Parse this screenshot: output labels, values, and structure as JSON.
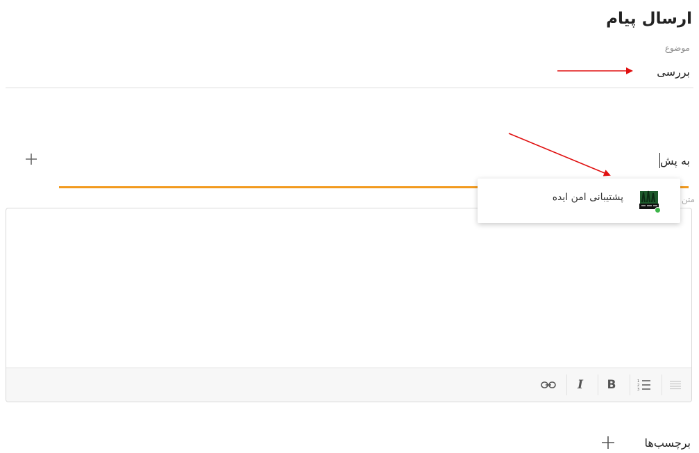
{
  "page": {
    "title": "ارسال پیام"
  },
  "subject": {
    "label": "موضوع",
    "value": "بررسی"
  },
  "to": {
    "value": "به پش",
    "add_icon": "plus-icon"
  },
  "body": {
    "label": "متن"
  },
  "suggestions": [
    {
      "name": "پشتیبانی امن ایده",
      "status": "online"
    }
  ],
  "toolbar": {
    "buttons": [
      "align-icon",
      "numbered-list-icon",
      "bold-icon",
      "italic-icon",
      "link-icon"
    ],
    "bold_label": "B",
    "italic_label": "I"
  },
  "tags": {
    "label": "برچسب‌ها",
    "add_icon": "plus-icon"
  },
  "colors": {
    "accent": "#f29a1e",
    "annotation_arrow": "#e01010",
    "online": "#3db54a"
  }
}
